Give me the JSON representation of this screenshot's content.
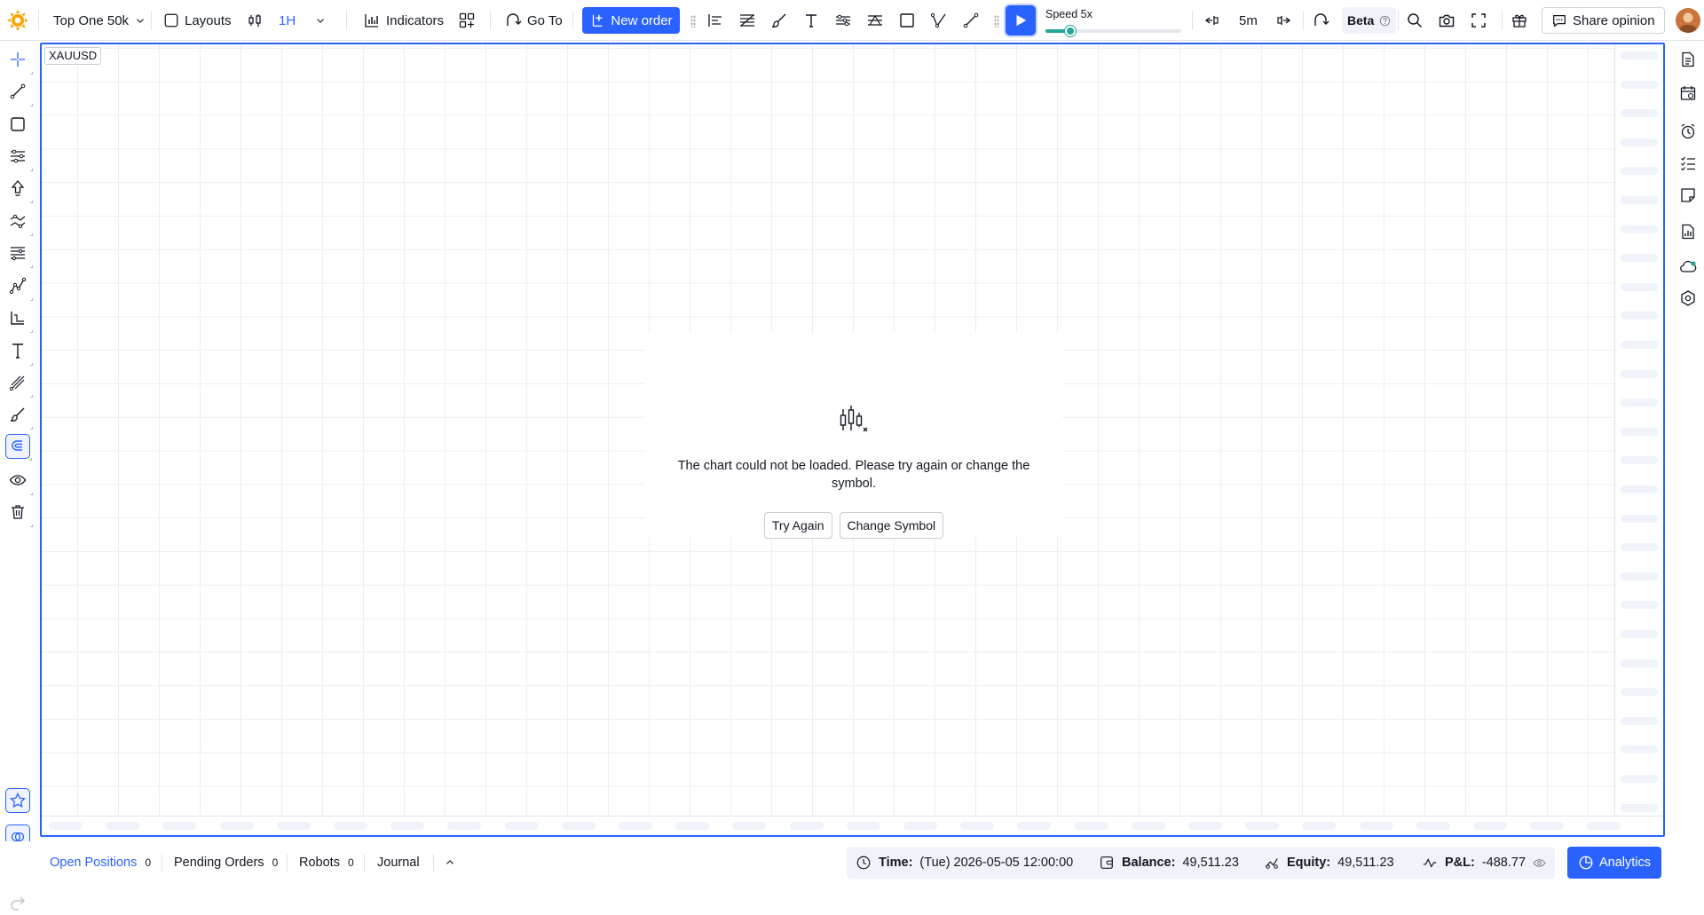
{
  "toolbar": {
    "account": "Top One 50k",
    "layouts": "Layouts",
    "interval": "1H",
    "indicators": "Indicators",
    "goto": "Go To",
    "new_order": "New order",
    "speed_label": "Speed 5x",
    "speed_fraction": 0.18,
    "step_interval": "5m",
    "beta": "Beta",
    "share": "Share opinion",
    "accent_color": "#2962ff"
  },
  "chart": {
    "symbol": "XAUUSD",
    "error_message": "The chart could not be loaded. Please try again or change the symbol.",
    "try_again": "Try Again",
    "change_symbol": "Change Symbol"
  },
  "bottom": {
    "tabs": [
      {
        "label": "Open Positions",
        "count": "0"
      },
      {
        "label": "Pending Orders",
        "count": "0"
      },
      {
        "label": "Robots",
        "count": "0"
      },
      {
        "label": "Journal"
      }
    ],
    "time_label": "Time:",
    "time_value": "(Tue) 2026-05-05 12:00:00",
    "balance_label": "Balance:",
    "balance_value": "49,511.23",
    "equity_label": "Equity:",
    "equity_value": "49,511.23",
    "pnl_label": "P&L:",
    "pnl_value": "-488.77",
    "analytics": "Analytics"
  },
  "icons": {
    "left": [
      "crosshair-icon",
      "trend-line-icon",
      "rectangle-icon",
      "fib-retracement-icon",
      "arrow-up-icon",
      "pattern-icon",
      "parallel-channel-icon",
      "xabcd-pattern-icon",
      "measure-icon",
      "text-icon",
      "pitchfork-icon",
      "brush-icon",
      "magnet-icon",
      "eye-icon",
      "trash-icon",
      "favorites-icon",
      "sync-drawings-icon",
      "undo-icon",
      "redo-icon"
    ],
    "right": [
      "notes-icon",
      "calendar-icon",
      "alarm-icon",
      "checklist-icon",
      "sticker-icon",
      "report-icon",
      "cloud-icon",
      "settings-icon",
      "dark-mode-icon"
    ]
  }
}
